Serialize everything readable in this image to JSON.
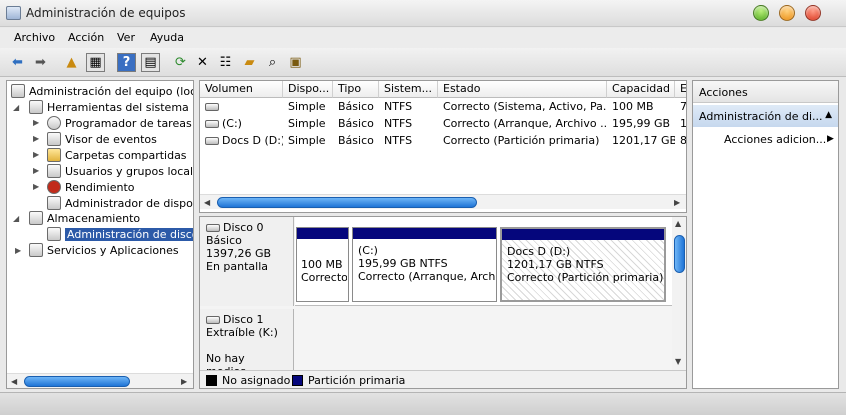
{
  "window": {
    "title": "Administración de equipos"
  },
  "menu": [
    "Archivo",
    "Acción",
    "Ver",
    "Ayuda"
  ],
  "toolbar": {
    "icons": [
      "back-arrow-icon",
      "forward-arrow-icon",
      "up-folder-icon",
      "show-hide-tree-icon",
      "help-icon",
      "show-hide-action-pane-icon",
      "refresh-icon",
      "delete-icon",
      "properties-icon",
      "open-folder-icon",
      "search-icon",
      "export-icon"
    ]
  },
  "tree": {
    "root": "Administración del equipo (local)",
    "groups": [
      {
        "label": "Herramientas del sistema",
        "children": [
          "Programador de tareas",
          "Visor de eventos",
          "Carpetas compartidas",
          "Usuarios y grupos locales",
          "Rendimiento",
          "Administrador de dispositivos"
        ]
      },
      {
        "label": "Almacenamiento",
        "children": [
          "Administración de discos"
        ]
      },
      {
        "label": "Servicios y Aplicaciones",
        "children": []
      }
    ],
    "selected": "Administración de discos"
  },
  "volumes": {
    "columns": [
      "Volumen",
      "Dispo...",
      "Tipo",
      "Sistem...",
      "Estado",
      "Capacidad",
      "E"
    ],
    "rows": [
      [
        "",
        "Simple",
        "Básico",
        "NTFS",
        "Correcto (Sistema, Activo, Pa...",
        "100 MB",
        "7"
      ],
      [
        "(C:)",
        "Simple",
        "Básico",
        "NTFS",
        "Correcto (Arranque, Archivo ...",
        "195,99 GB",
        "1"
      ],
      [
        "Docs D (D:)",
        "Simple",
        "Básico",
        "NTFS",
        "Correcto (Partición primaria)",
        "1201,17 GB",
        "8"
      ]
    ]
  },
  "disks": [
    {
      "name": "Disco 0",
      "type": "Básico",
      "size": "1397,26 GB",
      "status": "En pantalla",
      "partitions": [
        {
          "line1": "",
          "line2": "100 MB",
          "line3": "Correcto"
        },
        {
          "line1": "(C:)",
          "line2": "195,99 GB NTFS",
          "line3": "Correcto (Arranque, Archivo"
        },
        {
          "line1": "Docs D  (D:)",
          "line2": "1201,17 GB NTFS",
          "line3": "Correcto (Partición primaria)"
        }
      ]
    },
    {
      "name": "Disco 1",
      "type": "Extraíble (K:)",
      "size": "",
      "status": "No hay medios"
    }
  ],
  "legend": [
    {
      "label": "No asignado",
      "color": "#000000"
    },
    {
      "label": "Partición primaria",
      "color": "#05067c"
    }
  ],
  "actions": {
    "header": "Acciones",
    "section": "Administración de di...",
    "item": "Acciones adicion..."
  },
  "colors": {
    "accent": "#2c5aa8",
    "primary_partition": "#05067c",
    "scroll_thumb": "#1f74d6"
  }
}
